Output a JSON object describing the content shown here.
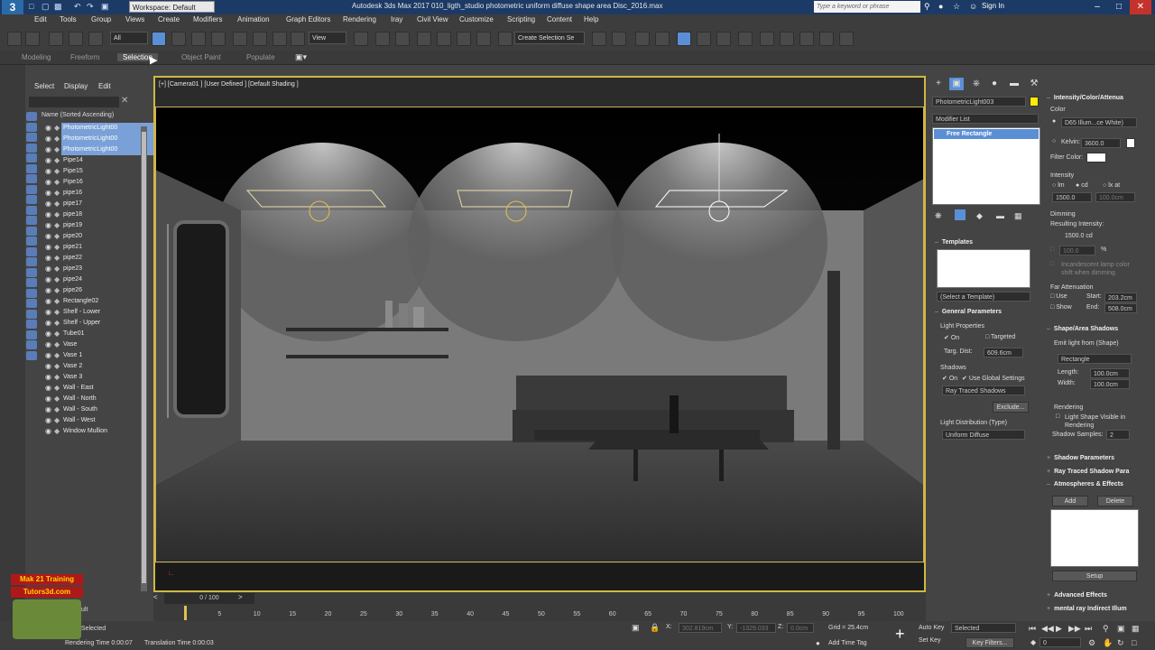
{
  "titlebar": {
    "app_icon": "3",
    "workspace": "Workspace: Default",
    "title": "Autodesk 3ds Max 2017    010_ligth_studio photometric uniform diffuse shape area Disc_2016.max",
    "search_placeholder": "Type a keyword or phrase",
    "sign_in": "Sign In"
  },
  "menu": [
    "Edit",
    "Tools",
    "Group",
    "Views",
    "Create",
    "Modifiers",
    "Animation",
    "Graph Editors",
    "Rendering",
    "Iray",
    "Civil View",
    "Customize",
    "Scripting",
    "Content",
    "Help"
  ],
  "toolbar": {
    "filter": "All",
    "ref_coord": "View",
    "selection_set": "Create Selection Se"
  },
  "ribbon_tabs": [
    "Modeling",
    "Freeform",
    "Selection",
    "Object Paint",
    "Populate"
  ],
  "explorer": {
    "tabs": [
      "Select",
      "Display",
      "Edit"
    ],
    "sort_header": "Name (Sorted Ascending)",
    "items": [
      {
        "name": "PhotometricLight00",
        "selected": true
      },
      {
        "name": "PhotometricLight00",
        "selected": true
      },
      {
        "name": "PhotometricLight00",
        "selected": true
      },
      {
        "name": "Pipe14"
      },
      {
        "name": "Pipe15"
      },
      {
        "name": "Pipe16"
      },
      {
        "name": "pipe16"
      },
      {
        "name": "pipe17"
      },
      {
        "name": "pipe18"
      },
      {
        "name": "pipe19"
      },
      {
        "name": "pipe20"
      },
      {
        "name": "pipe21"
      },
      {
        "name": "pipe22"
      },
      {
        "name": "pipe23"
      },
      {
        "name": "pipe24"
      },
      {
        "name": "pipe26"
      },
      {
        "name": "Rectangle02"
      },
      {
        "name": "Shelf - Lower"
      },
      {
        "name": "Shelf - Upper"
      },
      {
        "name": "Tube01"
      },
      {
        "name": "Vase"
      },
      {
        "name": "Vase 1"
      },
      {
        "name": "Vase 2"
      },
      {
        "name": "Vase 3"
      },
      {
        "name": "Wall - East"
      },
      {
        "name": "Wall - North"
      },
      {
        "name": "Wall - South"
      },
      {
        "name": "Wall - West"
      },
      {
        "name": "Window Mullion"
      }
    ]
  },
  "viewport": {
    "label": "[+] [Camera01 ] [User Defined ] [Default Shading ]"
  },
  "timeline": {
    "frame": "0 / 100",
    "ticks": [
      "5",
      "10",
      "15",
      "20",
      "25",
      "30",
      "35",
      "40",
      "45",
      "50",
      "55",
      "60",
      "65",
      "70",
      "75",
      "80",
      "85",
      "90",
      "95",
      "100"
    ]
  },
  "status": {
    "selected": "t Selected",
    "ult": "ult",
    "rendering_time": "Rendering Time  0:00:07",
    "translation_time": "Translation Time  0:00:03",
    "x": "302.819cm",
    "y": "-1329.033",
    "z": "0.0cm",
    "grid": "Grid = 25.4cm",
    "add_time_tag": "Add Time Tag",
    "auto_key": "Auto Key",
    "set_key": "Set Key",
    "selected_dropdown": "Selected",
    "key_filters": "Key Filters...",
    "frame_spinner": "0"
  },
  "command_panel": {
    "object_name": "PhotometricLight003",
    "modifier_list": "Modifier List",
    "stack_item": "Free Rectangle",
    "templates": {
      "title": "Templates",
      "select": "(Select a Template)"
    },
    "general": {
      "title": "General Parameters",
      "light_props": "Light Properties",
      "on": "On",
      "targeted": "Targeted",
      "targ_dist_label": "Targ. Dist:",
      "targ_dist": "609.6cm",
      "shadows": "Shadows",
      "shadows_on": "On",
      "use_global": "Use Global Settings",
      "shadow_type": "Ray Traced Shadows",
      "exclude": "Exclude...",
      "dist_label": "Light Distribution (Type)",
      "dist_type": "Uniform Diffuse"
    },
    "intensity": {
      "title": "Intensity/Color/Attenua",
      "color_label": "Color",
      "color_preset": "D65 Illum...ce White)",
      "kelvin_label": "Kelvin:",
      "kelvin": "3600.0",
      "filter_label": "Filter Color:",
      "intensity_label": "Intensity",
      "lm": "lm",
      "cd": "cd",
      "lxat": "lx at",
      "intensity_value": "1500.0",
      "lx_dist": "100.0cm",
      "dimming": "Dimming",
      "resulting": "Resulting Intensity:",
      "resulting_value": "1500.0 cd",
      "percent_value": "100.0",
      "percent": "%",
      "incandescent": "Incandescent lamp color shift when dimming",
      "far_atten": "Far Attenuation",
      "use": "Use",
      "show": "Show",
      "start_label": "Start:",
      "start": "203.2cm",
      "end_label": "End:",
      "end": "508.0cm"
    },
    "shape": {
      "title": "Shape/Area Shadows",
      "emit": "Emit light from (Shape)",
      "shape_type": "Rectangle",
      "length_label": "Length:",
      "length": "100.0cm",
      "width_label": "Width:",
      "width": "100.0cm",
      "rendering": "Rendering",
      "visible": "Light Shape Visible in Rendering",
      "samples_label": "Shadow Samples:",
      "samples": "2"
    },
    "rollouts": {
      "shadow_params": "Shadow Parameters",
      "ray_traced": "Ray Traced Shadow Para",
      "atmospheres": "Atmospheres & Effects",
      "add": "Add",
      "delete": "Delete",
      "setup": "Setup",
      "advanced": "Advanced Effects",
      "mental_ray": "mental ray Indirect Illum"
    }
  },
  "watermark": {
    "line1": "Mak 21 Training",
    "line2": "Tutors3d.com"
  },
  "colors": {
    "viewport_frame": "#d0b840",
    "selection_blue": "#7aa0d8",
    "title_blue": "#1c3a66"
  }
}
